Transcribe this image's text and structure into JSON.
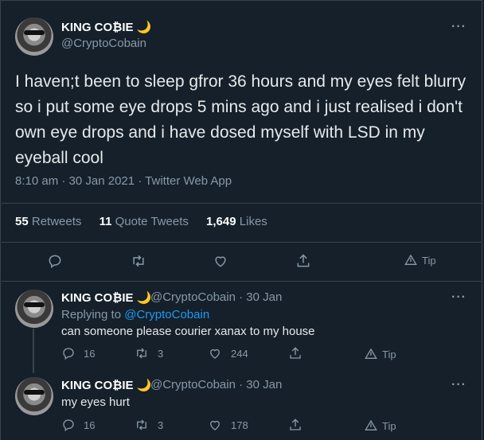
{
  "main_tweet": {
    "name": "KING CO₿IE",
    "moon": "🌙",
    "handle": "@CryptoCobain",
    "text": "I haven;t been to sleep gfror 36 hours and my eyes felt blurry so i put some eye drops 5 mins ago and i just realised i don't own eye drops and i have dosed myself with LSD in my eyeball cool",
    "time": "8:10 am · 30 Jan 2021 · Twitter Web App",
    "stats": {
      "retweets_count": "55",
      "retweets_label": "Retweets",
      "quotes_count": "11",
      "quotes_label": "Quote Tweets",
      "likes_count": "1,649",
      "likes_label": "Likes"
    },
    "actions": {
      "tip_label": "Tip"
    }
  },
  "replies": [
    {
      "name": "KING CO₿IE",
      "moon": "🌙",
      "handle_date": "@CryptoCobain · 30 Jan",
      "replying_prefix": "Replying to",
      "replying_handle": "@CryptoCobain",
      "text": "can someone please courier xanax to my house",
      "reply_count": "16",
      "retweet_count": "3",
      "like_count": "244",
      "tip_label": "Tip"
    },
    {
      "name": "KING CO₿IE",
      "moon": "🌙",
      "handle_date": "@CryptoCobain · 30 Jan",
      "text": "my eyes hurt",
      "reply_count": "16",
      "retweet_count": "3",
      "like_count": "178",
      "tip_label": "Tip"
    }
  ],
  "more_glyph": "···",
  "colors": {
    "background": "#15202b",
    "muted": "#8899a6",
    "link": "#1d9bf0",
    "border": "#38444d"
  },
  "icons": [
    "reply-icon",
    "retweet-icon",
    "like-icon",
    "share-icon",
    "tip-icon",
    "more-icon"
  ]
}
